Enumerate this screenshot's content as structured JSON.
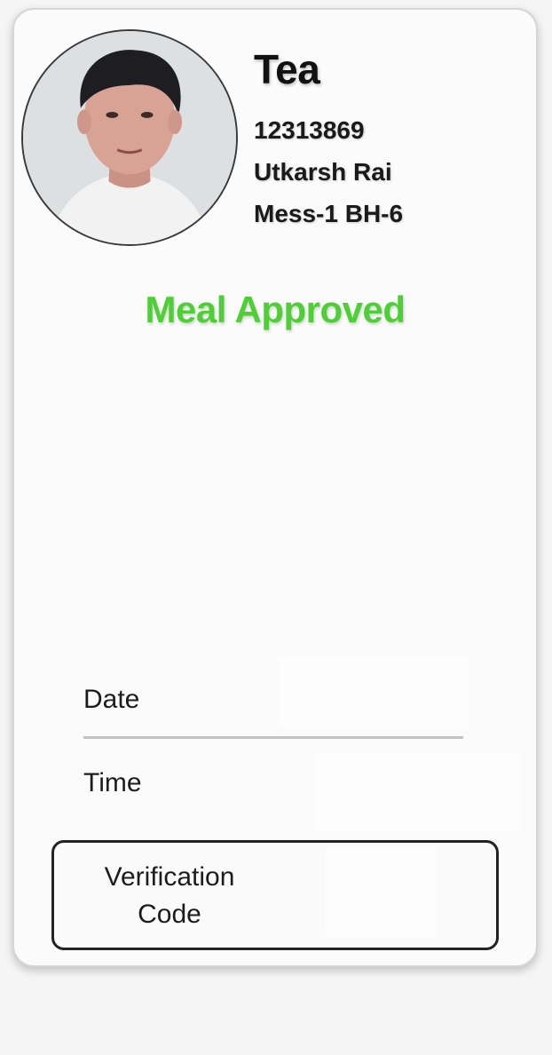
{
  "meal": {
    "type": "Tea",
    "status": "Meal Approved"
  },
  "student": {
    "registration_number": "12313869",
    "name": "Utkarsh Rai",
    "mess": "Mess-1 BH-6",
    "photo": "student-photo"
  },
  "fields": {
    "date_label": "Date",
    "time_label": "Time",
    "verification_label_line1": "Verification",
    "verification_label_line2": "Code"
  },
  "colors": {
    "status": "#4fcf36"
  }
}
